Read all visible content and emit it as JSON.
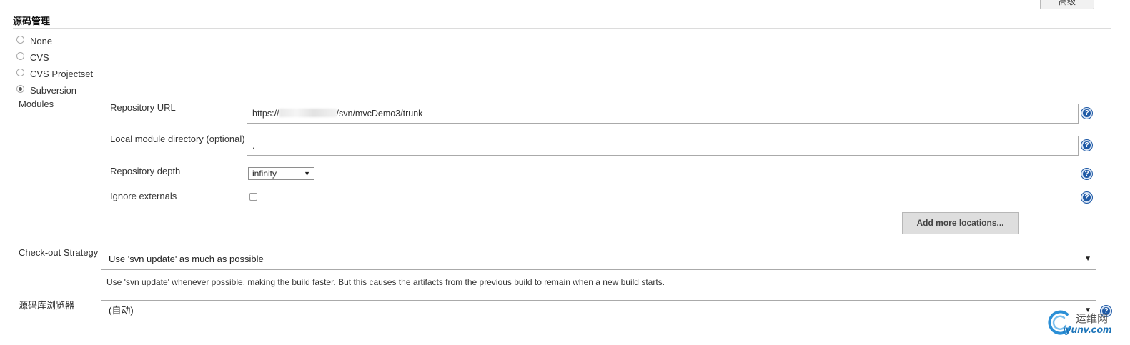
{
  "header": {
    "section_title": "源码管理",
    "top_button_label": "高级"
  },
  "scm_options": [
    {
      "label": "None",
      "selected": false
    },
    {
      "label": "CVS",
      "selected": false
    },
    {
      "label": "CVS Projectset",
      "selected": false
    },
    {
      "label": "Subversion",
      "selected": true
    }
  ],
  "modules": {
    "label": "Modules",
    "repository_url": {
      "label": "Repository URL",
      "value_prefix": "https://",
      "value_suffix": "/svn/mvcDemo3/trunk"
    },
    "local_module_directory": {
      "label": "Local module directory (optional)",
      "value": "."
    },
    "repository_depth": {
      "label": "Repository depth",
      "value": "infinity"
    },
    "ignore_externals": {
      "label": "Ignore externals",
      "checked": false
    },
    "add_more_button": "Add more locations..."
  },
  "checkout_strategy": {
    "label": "Check-out Strategy",
    "value": "Use 'svn update' as much as possible",
    "description": "Use 'svn update' whenever possible, making the build faster. But this causes the artifacts from the previous build to remain when a new build starts."
  },
  "repository_browser": {
    "label": "源码库浏览器",
    "value": "(自动)"
  },
  "help_icon_glyph": "?",
  "select_arrow_glyph": "▼",
  "watermark": {
    "cn": "运维网",
    "en": "iyunv.com"
  }
}
